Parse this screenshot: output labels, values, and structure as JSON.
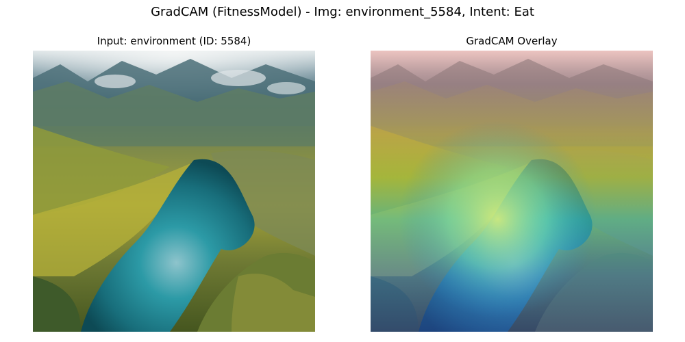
{
  "figure": {
    "title": "GradCAM (FitnessModel) - Img: environment_5584, Intent: Eat"
  },
  "panels": [
    {
      "title": "Input: environment (ID: 5584)",
      "content": "aerial-landscape-lake-mountains"
    },
    {
      "title": "GradCAM Overlay",
      "content": "aerial-landscape-with-heatmap-overlay"
    }
  ]
}
